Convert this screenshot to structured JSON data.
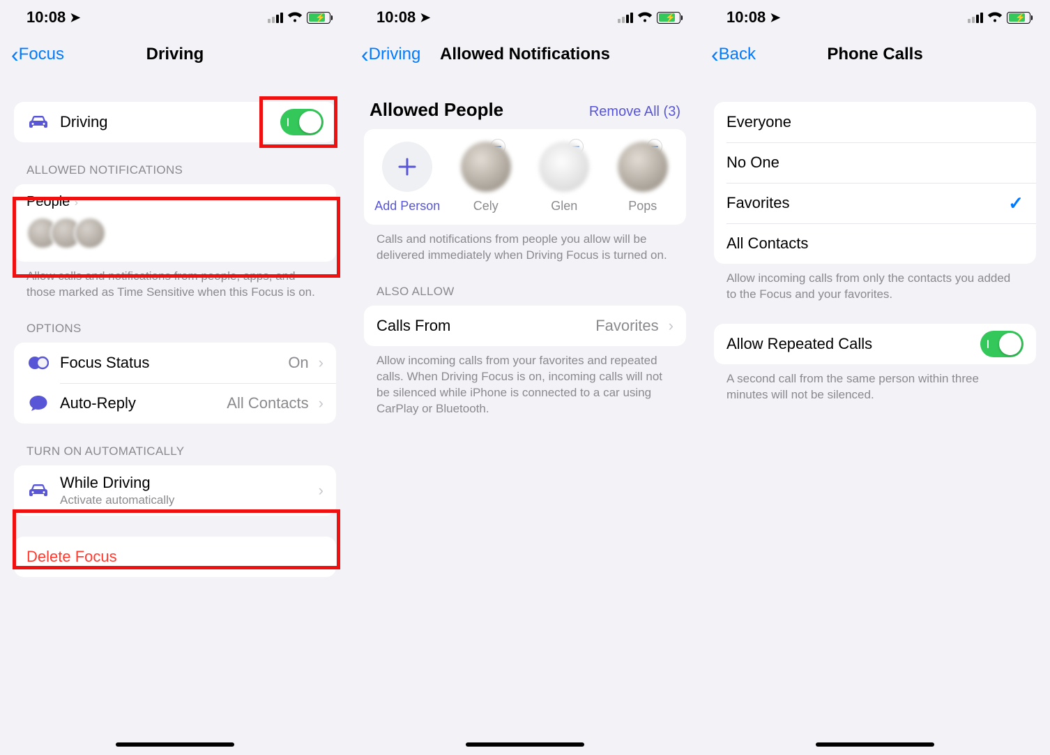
{
  "status": {
    "time": "10:08"
  },
  "screen1": {
    "back": "Focus",
    "title": "Driving",
    "driving_row_label": "Driving",
    "allowed_header": "ALLOWED NOTIFICATIONS",
    "people_label": "People",
    "allowed_footer": "Allow calls and notifications from people, apps, and those marked as Time Sensitive when this Focus is on.",
    "options_header": "OPTIONS",
    "focus_status_label": "Focus Status",
    "focus_status_value": "On",
    "auto_reply_label": "Auto-Reply",
    "auto_reply_value": "All Contacts",
    "auto_header": "TURN ON AUTOMATICALLY",
    "while_driving_label": "While Driving",
    "while_driving_sub": "Activate automatically",
    "delete_label": "Delete Focus"
  },
  "screen2": {
    "back": "Driving",
    "title": "Allowed Notifications",
    "people_header": "Allowed People",
    "remove_all": "Remove All (3)",
    "add_person": "Add Person",
    "contacts": [
      "Cely",
      "Glen",
      "Pops"
    ],
    "people_footer": "Calls and notifications from people you allow will be delivered immediately when Driving Focus is turned on.",
    "also_allow_header": "ALSO ALLOW",
    "calls_from_label": "Calls From",
    "calls_from_value": "Favorites",
    "calls_footer": "Allow incoming calls from your favorites and repeated calls. When Driving Focus is on, incoming calls will not be silenced while iPhone is connected to a car using CarPlay or Bluetooth."
  },
  "screen3": {
    "back": "Back",
    "title": "Phone Calls",
    "options": [
      "Everyone",
      "No One",
      "Favorites",
      "All Contacts"
    ],
    "selected_index": 2,
    "options_footer": "Allow incoming calls from only the contacts you added to the Focus and your favorites.",
    "repeated_label": "Allow Repeated Calls",
    "repeated_footer": "A second call from the same person within three minutes will not be silenced."
  }
}
